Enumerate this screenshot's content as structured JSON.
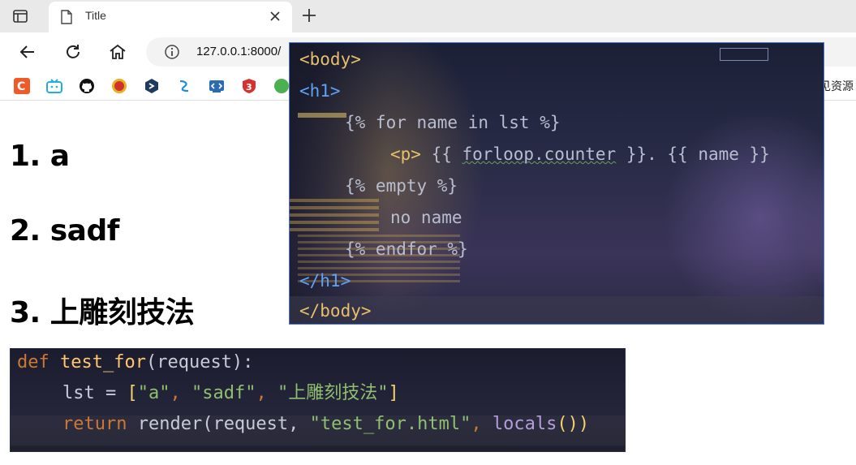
{
  "browser": {
    "tab": {
      "title": "Title"
    },
    "address": {
      "url": "127.0.0.1:8000/"
    },
    "bookmarks_more": "见资源"
  },
  "page": {
    "headings": [
      "1. a",
      "2. sadf",
      "3. 上雕刻技法"
    ]
  },
  "template_code": {
    "body_open": "<body>",
    "h1_open": "<h1>",
    "for_line": "{% for name in lst %}",
    "p_tag": "<p>",
    "p_content_pre": " {{ ",
    "forloop": "forloop.counter",
    "p_content_mid": " }}. {{ name }}",
    "empty_line": "{% empty %}",
    "no_name": "no name",
    "endfor_line": "{% endfor %}",
    "h1_close": "</h1>",
    "body_close": "</body>"
  },
  "python_code": {
    "def_kw": "def",
    "func_name": "test_for",
    "def_rest": "(request):",
    "lst_var": "lst = ",
    "list_open": "[",
    "item1": "\"a\"",
    "comma1": ", ",
    "item2": "\"sadf\"",
    "comma2": ", ",
    "item3": "\"上雕刻技法\"",
    "list_close": "]",
    "return_kw": "return",
    "render_call": " render(request, ",
    "template_name": "\"test_for.html\"",
    "comma3": ", ",
    "locals_call": "locals",
    "parens": "()",
    "close_paren": ")"
  },
  "colors": {
    "accent": "#4a74c4",
    "keyword": "#cc7832",
    "string": "#8fbf6f",
    "function": "#ffc66d",
    "tag": "#e8bf6a"
  }
}
